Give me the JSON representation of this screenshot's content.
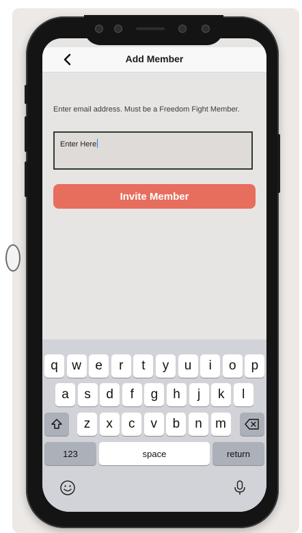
{
  "header": {
    "title": "Add Member",
    "back_icon": "chevron-left-icon"
  },
  "form": {
    "prompt": "Enter email address. Must be a Freedom Fight Member.",
    "email_value": "Enter Here",
    "invite_label": "Invite Member"
  },
  "keyboard": {
    "row1": [
      "q",
      "w",
      "e",
      "r",
      "t",
      "y",
      "u",
      "i",
      "o",
      "p"
    ],
    "row2": [
      "a",
      "s",
      "d",
      "f",
      "g",
      "h",
      "j",
      "k",
      "l"
    ],
    "row3": [
      "z",
      "x",
      "c",
      "v",
      "b",
      "n",
      "m"
    ],
    "numbers_label": "123",
    "space_label": "space",
    "return_label": "return",
    "shift_icon": "shift-icon",
    "delete_icon": "backspace-icon",
    "emoji_icon": "emoji-icon",
    "mic_icon": "microphone-icon"
  },
  "colors": {
    "accent": "#e76e5c",
    "input_border": "#2c3b2f",
    "screen_bg": "#e7e5e3",
    "keyboard_bg": "#d2d3d8"
  }
}
